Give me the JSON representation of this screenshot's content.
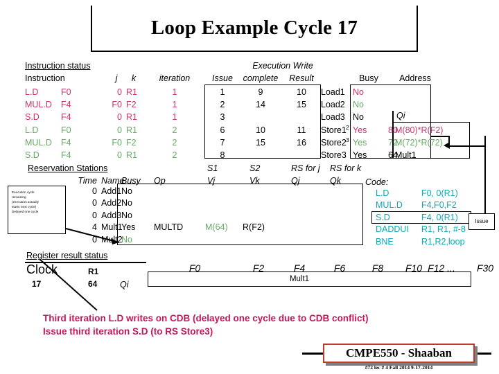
{
  "title": "Loop Example Cycle 17",
  "instruction_status": {
    "section_label": "Instruction status",
    "headers": {
      "instruction": "Instruction",
      "j": "j",
      "k": "k",
      "iteration": "iteration",
      "exec_write": "Execution Write",
      "issue": "Issue",
      "complete": "complete",
      "result": "Result"
    },
    "rows": [
      {
        "op": "L.D",
        "dest": "F0",
        "j": "0",
        "k": "R1",
        "iteration": "1",
        "issue": "1",
        "complete": "9",
        "result": "10",
        "color": "magenta"
      },
      {
        "op": "MUL.D",
        "dest": "F4",
        "j": "F0",
        "k": "F2",
        "iteration": "1",
        "issue": "2",
        "complete": "14",
        "result": "15",
        "color": "magenta"
      },
      {
        "op": "S.D",
        "dest": "F4",
        "j": "0",
        "k": "R1",
        "iteration": "1",
        "issue": "3",
        "complete": "",
        "result": "",
        "color": "magenta"
      },
      {
        "op": "L.D",
        "dest": "F0",
        "j": "0",
        "k": "R1",
        "iteration": "2",
        "issue": "6",
        "complete": "10",
        "result": "11",
        "color": "green"
      },
      {
        "op": "MUL.D",
        "dest": "F4",
        "j": "F0",
        "k": "F2",
        "iteration": "2",
        "issue": "7",
        "complete": "15",
        "result": "16",
        "color": "green"
      },
      {
        "op": "S.D",
        "dest": "F4",
        "j": "0",
        "k": "R1",
        "iteration": "2",
        "issue": "8",
        "complete": "",
        "result": "",
        "color": "green"
      }
    ]
  },
  "load_store_buffers": {
    "headers": {
      "busy": "Busy",
      "address": "Address",
      "qi": "Qi"
    },
    "rows": [
      {
        "name": "Load1",
        "sup": "",
        "busy": "No",
        "address": "",
        "qi": "",
        "color": "magenta"
      },
      {
        "name": "Load2",
        "sup": "",
        "busy": "No",
        "address": "",
        "qi": "",
        "color": "green"
      },
      {
        "name": "Load3",
        "sup": "",
        "busy": "No",
        "address": "",
        "qi": "",
        "color": "black"
      },
      {
        "name": "Store1",
        "sup": "2",
        "busy": "Yes",
        "address": "80",
        "qi": "M(80)*R(F2)",
        "color": "magenta"
      },
      {
        "name": "Store2",
        "sup": "3",
        "busy": "Yes",
        "address": "72",
        "qi": "M(72)*R(72)",
        "color": "green"
      },
      {
        "name": "Store3",
        "sup": "",
        "busy": "Yes",
        "address": "64",
        "qi": "Mult1",
        "color": "black"
      }
    ]
  },
  "reservation_stations": {
    "section_label": "Reservation Stations",
    "headers": {
      "time": "Time",
      "name": "Name",
      "busy": "Busy",
      "op": "Op",
      "s1": "S1",
      "s2": "S2",
      "vj": "Vj",
      "vk": "Vk",
      "rs_for_j": "RS for j",
      "rs_for_k": "RS for k",
      "qj": "Qj",
      "qk": "Qk"
    },
    "rows": [
      {
        "time": "0",
        "name": "Add1",
        "busy": "No",
        "op": "",
        "vj": "",
        "vk": "",
        "qj": "",
        "qk": "",
        "color": "black"
      },
      {
        "time": "0",
        "name": "Add2",
        "busy": "No",
        "op": "",
        "vj": "",
        "vk": "",
        "qj": "",
        "qk": "",
        "color": "black"
      },
      {
        "time": "0",
        "name": "Add3",
        "busy": "No",
        "op": "",
        "vj": "",
        "vk": "",
        "qj": "",
        "qk": "",
        "color": "black"
      },
      {
        "time": "4",
        "name": "Mult1",
        "busy": "Yes",
        "op": "MULTD",
        "vj": "M(64)",
        "vk": "R(F2)",
        "qj": "",
        "qk": "",
        "color": "black"
      },
      {
        "time": "0",
        "name": "Mult2",
        "busy": "No",
        "op": "",
        "vj": "",
        "vk": "",
        "qj": "",
        "qk": "",
        "color": "green"
      }
    ]
  },
  "annotation_note": {
    "lines": [
      "Execution cycle",
      "remaining",
      "(execution actually",
      "starts next cycle)",
      "Delayed one cycle"
    ]
  },
  "register_result_status": {
    "section_label": "Register result status",
    "clock_label": "Clock",
    "clock_value": "17",
    "r1_label": "R1",
    "r1_value": "64",
    "qi_label": "Qi",
    "registers": [
      "F0",
      "F2",
      "F4",
      "F6",
      "F8",
      "F10",
      "F12 ...",
      "F30"
    ],
    "values": [
      "",
      "",
      "Mult1",
      "",
      "",
      "",
      "",
      ""
    ]
  },
  "code": {
    "label": "Code:",
    "lines": [
      {
        "op": "L.D",
        "operands": "F0, 0(R1)"
      },
      {
        "op": "MUL.D",
        "operands": "F4,F0,F2"
      },
      {
        "op": "S.D",
        "operands": "F4, 0(R1)"
      },
      {
        "op": "DADDUI",
        "operands": "R1, R1, #-8"
      },
      {
        "op": "BNE",
        "operands": "R1,R2,loop"
      }
    ],
    "issue_badge": "Issue"
  },
  "caption": {
    "line1": "Third iteration L.D writes on CDB (delayed one cycle due to CDB conflict)",
    "line2": "Issue third iteration S.D (to RS Store3)"
  },
  "footer": {
    "course": "CMPE550 - Shaaban",
    "meta": "#72   lec # 4 Fall 2014   9-17-2014"
  },
  "colors": {
    "magenta": "#cc3366",
    "green": "#66aa66",
    "teal": "#0aa9b5",
    "caption": "#c2185b",
    "footer_border": "#c0392b"
  }
}
